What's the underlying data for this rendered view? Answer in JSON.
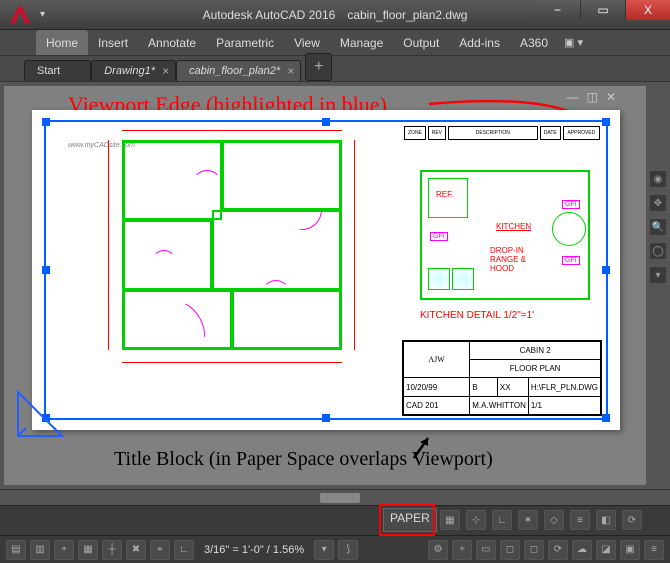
{
  "titlebar": {
    "app_name": "Autodesk AutoCAD 2016",
    "document": "cabin_floor_plan2.dwg",
    "min": "−",
    "max": "▭",
    "close": "X"
  },
  "menu": {
    "items": [
      "Home",
      "Insert",
      "Annotate",
      "Parametric",
      "View",
      "Manage",
      "Output",
      "Add-ins",
      "A360"
    ],
    "active_index": 0,
    "extras": "▣ ▾"
  },
  "filetabs": {
    "tabs": [
      {
        "label": "Start",
        "mod": ""
      },
      {
        "label": "Drawing1",
        "mod": "*"
      },
      {
        "label": "cabin_floor_plan2",
        "mod": "*"
      }
    ],
    "active_index": 2,
    "add": "+"
  },
  "annotations": {
    "viewport_edge": "Viewport Edge (highlighted in blue)",
    "title_block": "Title Block (in Paper Space overlaps Viewport)"
  },
  "drawing": {
    "watermark": "www.myCADsite.com",
    "kitchen_detail_title": "KITCHEN DETAIL 1/2\"=1'",
    "kitchen_labels": {
      "ref": "REF.",
      "kitchen": "KITCHEN",
      "dropin": "DROP-IN RANGE & HOOD",
      "gfi": "GFI"
    },
    "titleblock": {
      "designer": "AJW",
      "project": "CABIN 2",
      "sheet": "FLOOR PLAN",
      "date": "10/20/99",
      "cad": "CAD 201",
      "drawn": "M.A.WHITTON",
      "file": "H:\\FLR_PLN.DWG",
      "scale": "1/1",
      "rev_headers": [
        "ZONE",
        "REV",
        "DESCRIPTION",
        "DATE",
        "APPROVED"
      ]
    }
  },
  "top_right_icons": {
    "minimize": "—",
    "dock": "◫",
    "close": "✕"
  },
  "status": {
    "paper": "PAPER",
    "scale": "3/16\" = 1'-0\" / 1.56%"
  }
}
